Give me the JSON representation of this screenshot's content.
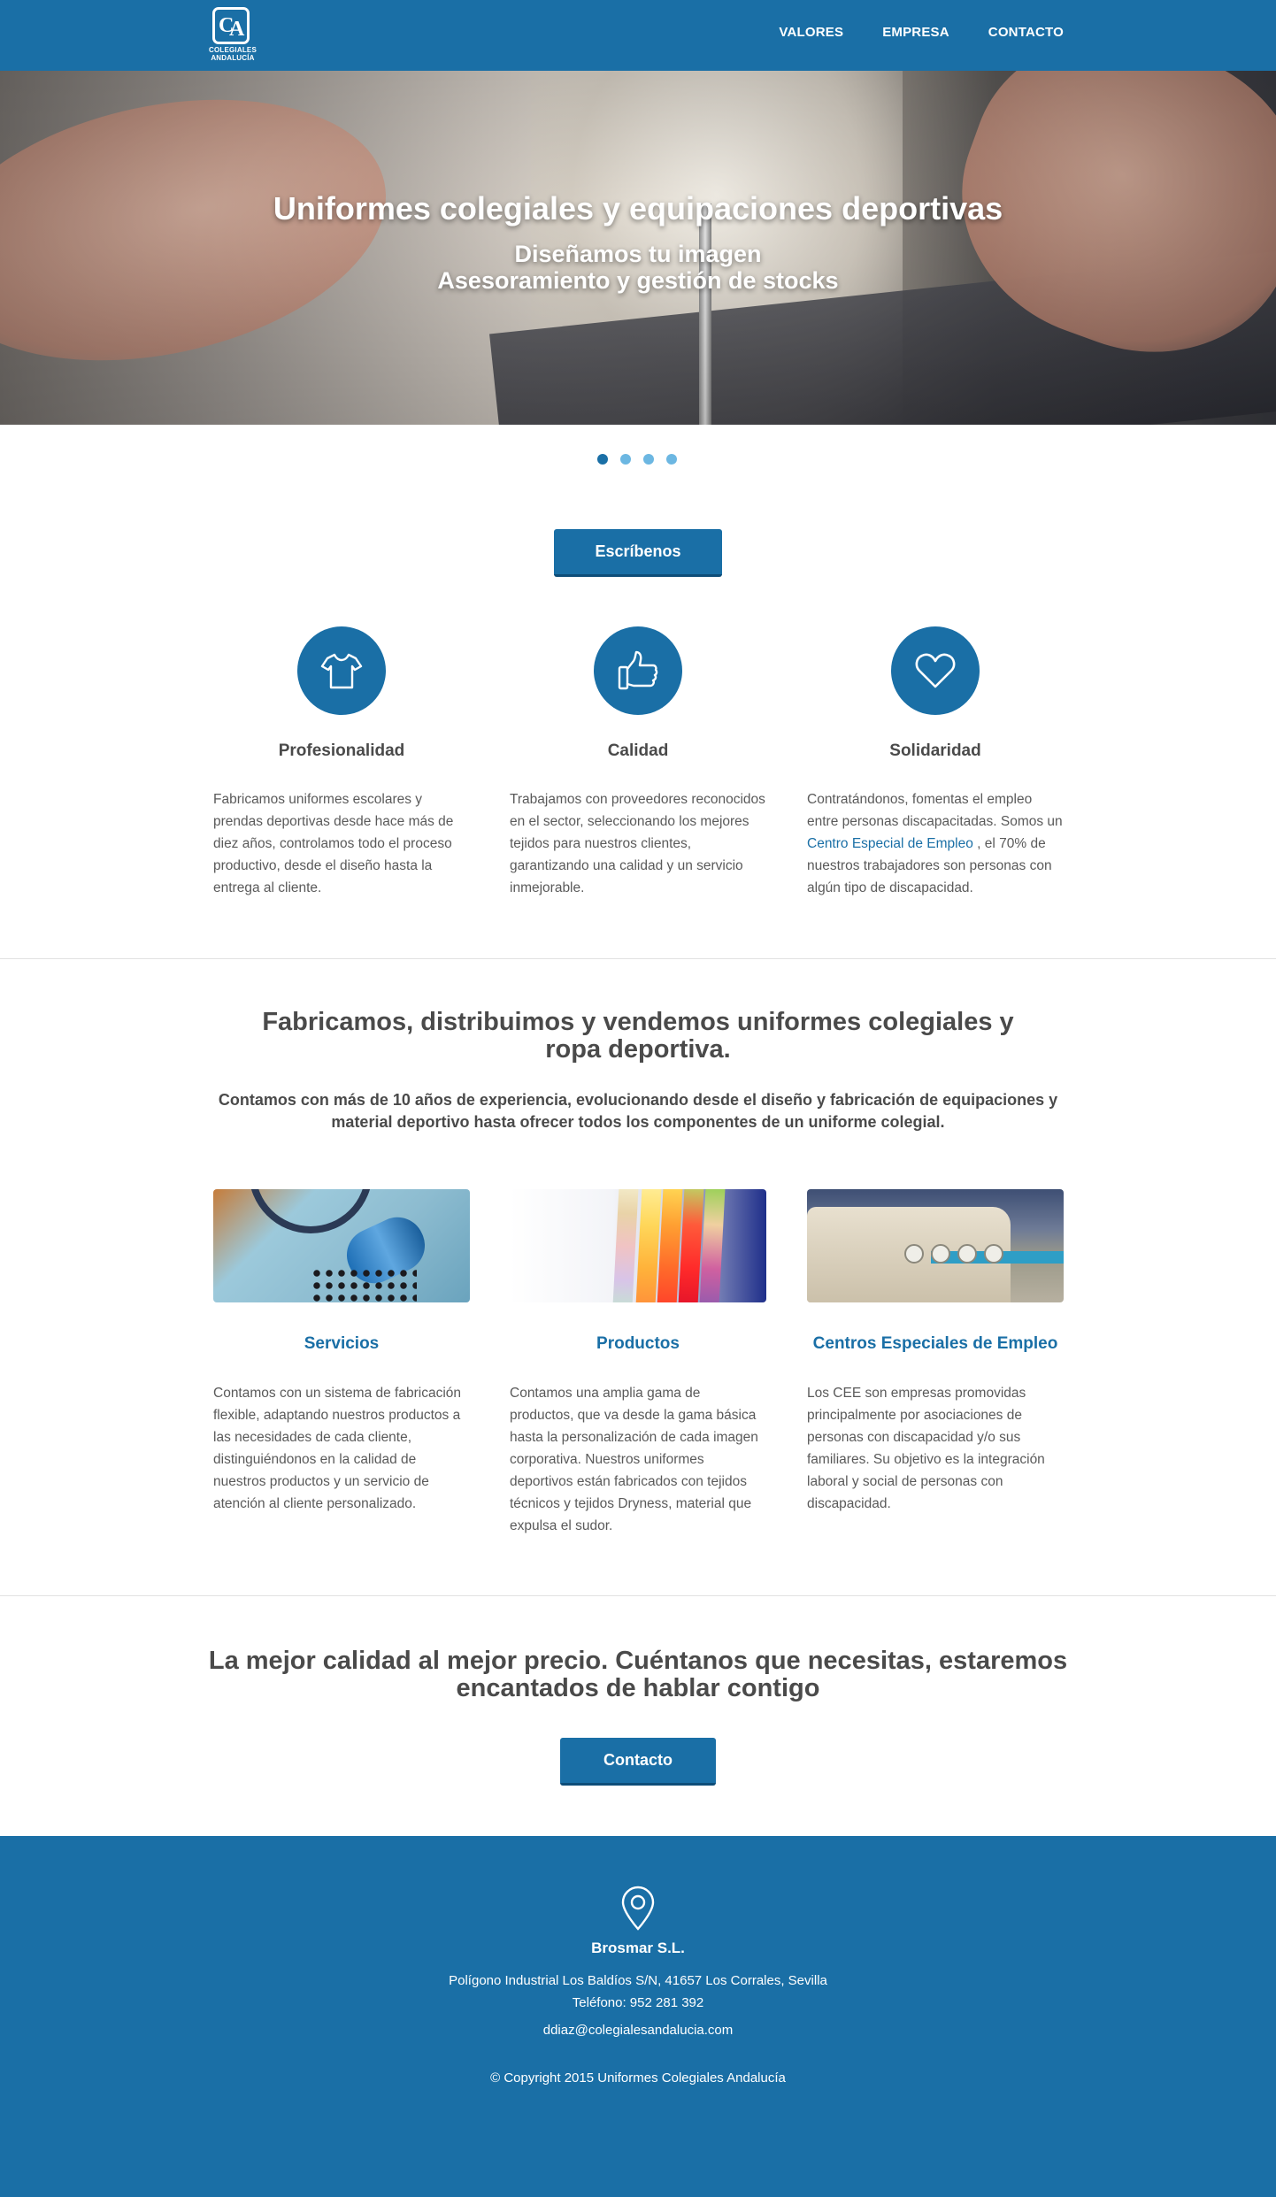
{
  "header": {
    "logo_text": "COLEGIALES ANDALUCÍA",
    "nav": [
      "VALORES",
      "EMPRESA",
      "CONTACTO"
    ]
  },
  "hero": {
    "title": "Uniformes colegiales y equipaciones deportivas",
    "subtitle_line1": "Diseñamos tu imagen",
    "subtitle_line2": "Asesoramiento y gestión de stocks"
  },
  "carousel": {
    "slides": 4,
    "active": 1
  },
  "cta_top": {
    "label": "Escríbenos"
  },
  "values": [
    {
      "icon": "tshirt-icon",
      "title": "Profesionalidad",
      "text": "Fabricamos uniformes escolares y prendas deportivas desde hace más de diez años, controlamos todo el proceso productivo, desde el diseño hasta la entrega al cliente."
    },
    {
      "icon": "thumbs-up-icon",
      "title": "Calidad",
      "text": "Trabajamos con proveedores reconocidos en el sector, seleccionando los mejores tejidos para nuestros clientes, garantizando una calidad y un servicio inmejorable."
    },
    {
      "icon": "heart-icon",
      "title": "Solidaridad",
      "text_before": "Contratándonos, fomentas el empleo entre personas discapacitadas. Somos un",
      "link": "Centro Especial de Empleo",
      "text_after": ", el 70% de nuestros trabajadores son personas con algún tipo de discapacidad."
    }
  ],
  "about": {
    "title": "Fabricamos, distribuimos y vendemos uniformes colegiales y ropa deportiva.",
    "subtitle": "Contamos con más de 10 años de experiencia, evolucionando desde el diseño y fabricación de equipaciones y material deportivo hasta ofrecer todos los componentes de un uniforme colegial."
  },
  "cards": [
    {
      "title": "Servicios",
      "text": "Contamos con un sistema de fabricación flexible, adaptando nuestros productos a las necesidades de cada cliente, distinguiéndonos en la calidad de nuestros productos y un servicio de atención al cliente personalizado."
    },
    {
      "title": "Productos",
      "text": "Contamos una amplia gama de productos, que va desde la gama básica hasta la personalización de cada imagen corporativa. Nuestros uniformes deportivos están fabricados con tejidos técnicos y tejidos Dryness, material que expulsa el sudor."
    },
    {
      "title": "Centros Especiales de Empleo",
      "text": "Los CEE son empresas promovidas principalmente por asociaciones de personas con discapacidad y/o sus familiares. Su objetivo es la integración laboral y social de personas con discapacidad."
    }
  ],
  "cta": {
    "title": "La mejor calidad al mejor precio. Cuéntanos que necesitas, estaremos encantados de hablar contigo",
    "button": "Contacto"
  },
  "footer": {
    "company": "Brosmar S.L.",
    "address": "Polígono Industrial Los Baldíos S/N, 41657 Los Corrales, Sevilla",
    "phone": "Teléfono: 952 281 392",
    "email": "ddiaz@colegialesandalucia.com",
    "copyright": "© Copyright 2015 Uniformes Colegiales Andalucía"
  },
  "colors": {
    "primary": "#1a6fa6",
    "dot_inactive": "#6cb7e2",
    "text": "#5a5a5a",
    "heading": "#4a4a4a"
  }
}
